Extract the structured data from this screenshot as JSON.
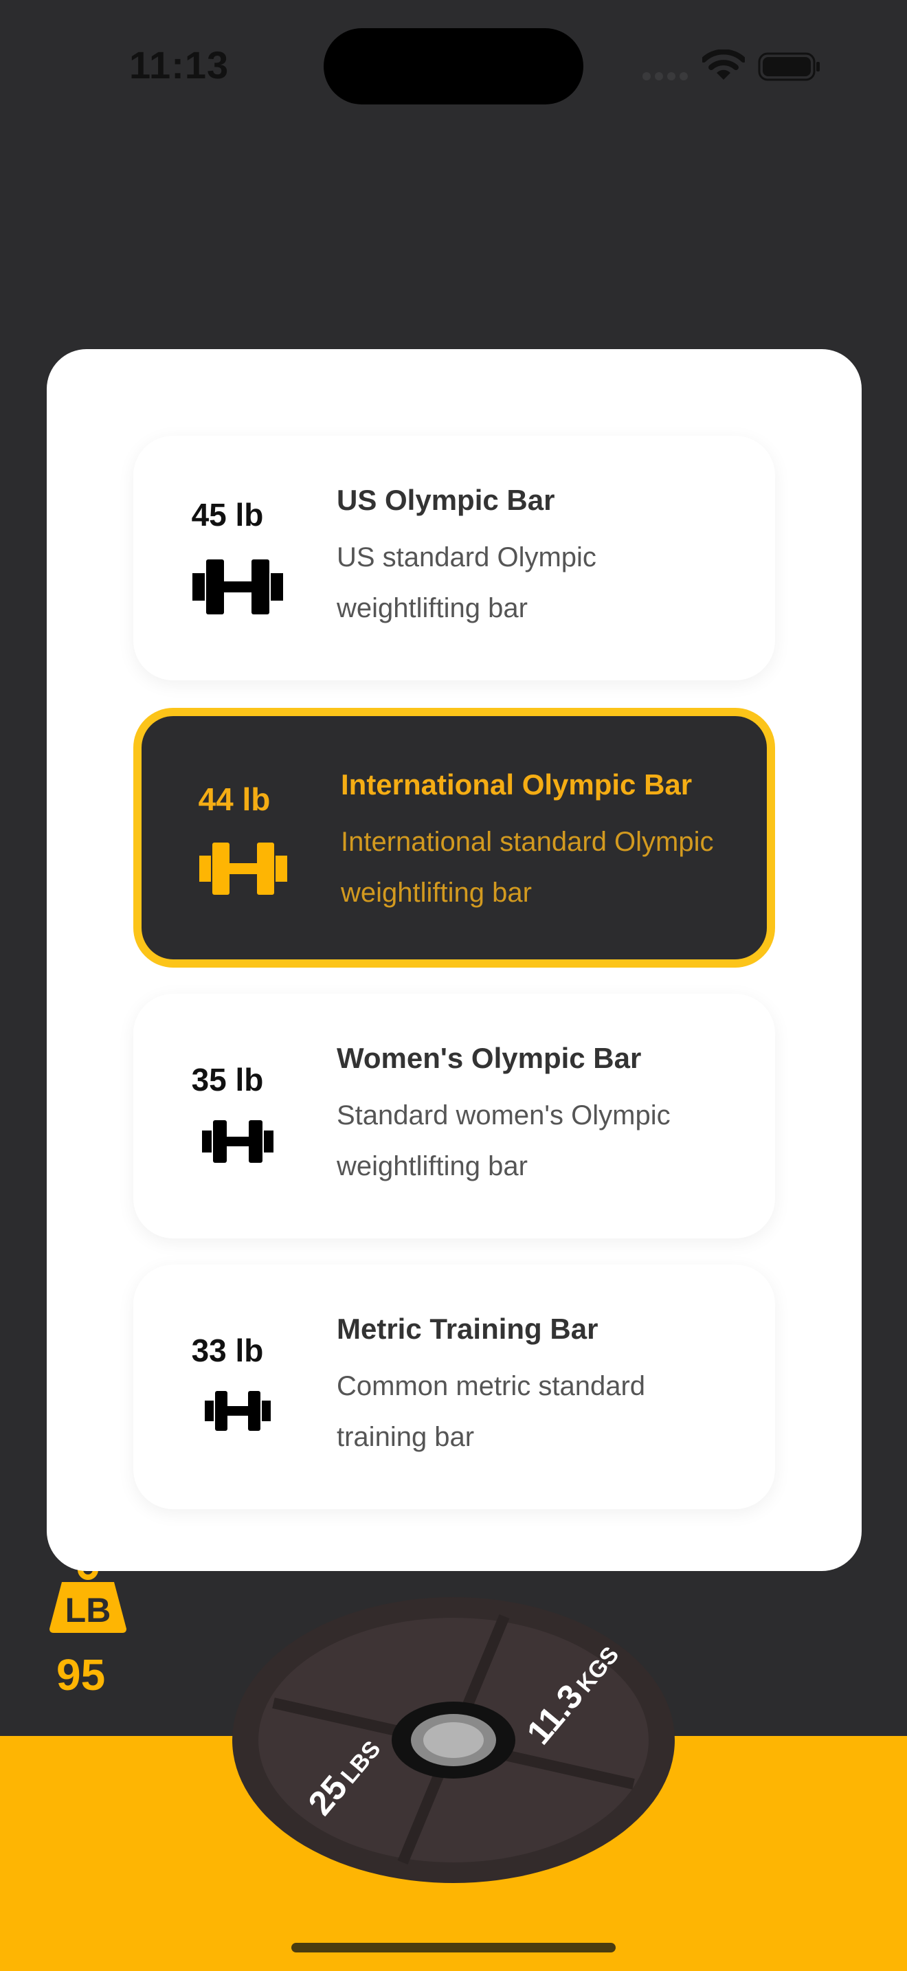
{
  "status": {
    "time": "11:13"
  },
  "bar_options": [
    {
      "weight": "45 lb",
      "title": "US Olympic Bar",
      "description": "US standard Olympic weightlifting bar",
      "selected": false
    },
    {
      "weight": "44 lb",
      "title": "International Olympic Bar",
      "description": "International standard Olympic weightlifting bar",
      "selected": true
    },
    {
      "weight": "35 lb",
      "title": "Women's Olympic Bar",
      "description": "Standard women's Olympic weightlifting bar",
      "selected": false
    },
    {
      "weight": "33 lb",
      "title": "Metric Training Bar",
      "description": "Common metric standard training bar",
      "selected": false
    }
  ],
  "unit_widget": {
    "unit_label": "LB",
    "total": "95"
  },
  "plate": {
    "lbs_value": "25",
    "lbs_unit": "LBS",
    "kgs_value": "11.3",
    "kgs_unit": "KGS"
  },
  "colors": {
    "accent": "#feb503",
    "selected_border": "#fcc419",
    "dark": "#2c2c2e"
  }
}
